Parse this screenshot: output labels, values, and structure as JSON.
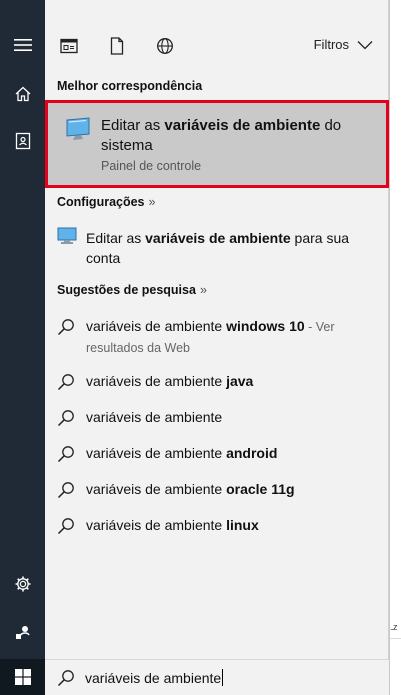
{
  "topbar": {
    "filters_label": "Filtros"
  },
  "best_match": {
    "heading": "Melhor correspondência",
    "title_pre": "Editar as ",
    "title_bold": "variáveis de ambiente",
    "title_post": " do sistema",
    "subtitle": "Painel de controle"
  },
  "settings": {
    "heading": "Configurações",
    "item_pre": "Editar as ",
    "item_bold": "variáveis de ambiente",
    "item_post": " para sua conta"
  },
  "suggestions": {
    "heading": "Sugestões de pesquisa",
    "items": [
      {
        "pre": "variáveis de ambiente ",
        "bold": "windows 10",
        "hint": " - Ver resultados da Web"
      },
      {
        "pre": "variáveis de ambiente ",
        "bold": "java",
        "hint": ""
      },
      {
        "pre": "variáveis de ambiente",
        "bold": "",
        "hint": ""
      },
      {
        "pre": "variáveis de ambiente ",
        "bold": "android",
        "hint": ""
      },
      {
        "pre": "variáveis de ambiente ",
        "bold": "oracle 11g",
        "hint": ""
      },
      {
        "pre": "variáveis de ambiente ",
        "bold": "linux",
        "hint": ""
      }
    ]
  },
  "search": {
    "value": "variáveis de ambiente"
  },
  "desktop": {
    "fragment": "..z"
  },
  "colors": {
    "rail": "#1f2a36",
    "panel": "#f2f2f2",
    "highlight_border": "#e3001b",
    "selected_bg": "#c9c9c9"
  }
}
